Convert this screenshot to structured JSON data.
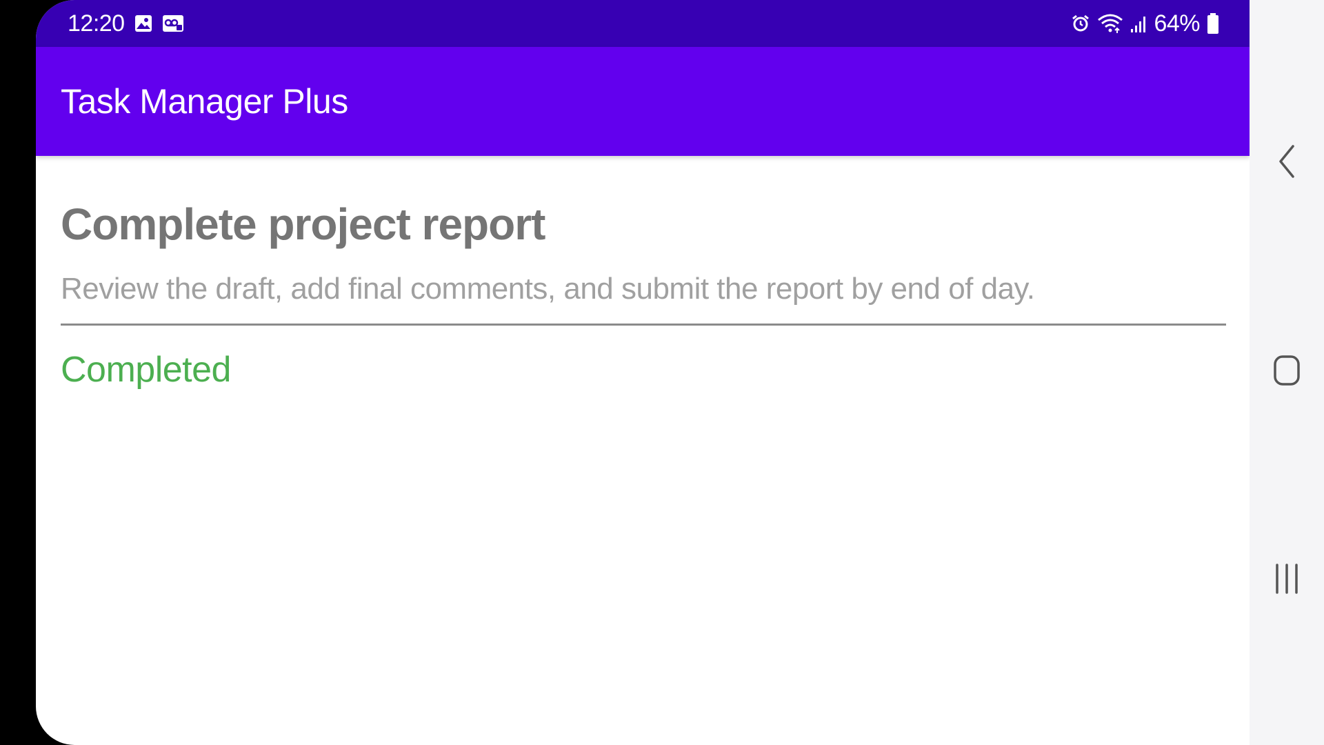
{
  "status_bar": {
    "time": "12:20",
    "battery_percent": "64%",
    "icons_left": [
      "gallery-icon",
      "voicemail-icon"
    ],
    "icons_right": [
      "alarm-icon",
      "wifi-icon",
      "signal-icon",
      "battery-icon"
    ]
  },
  "app_bar": {
    "title": "Task Manager Plus"
  },
  "task": {
    "title": "Complete project report",
    "description": "Review the draft, add final comments, and submit the report by end of day.",
    "status": "Completed"
  },
  "navigation": {
    "buttons": [
      "back-icon",
      "home-icon",
      "recents-icon"
    ]
  },
  "colors": {
    "status_bar": "#3700b3",
    "app_bar": "#6200ee",
    "status_completed": "#4caf50"
  }
}
